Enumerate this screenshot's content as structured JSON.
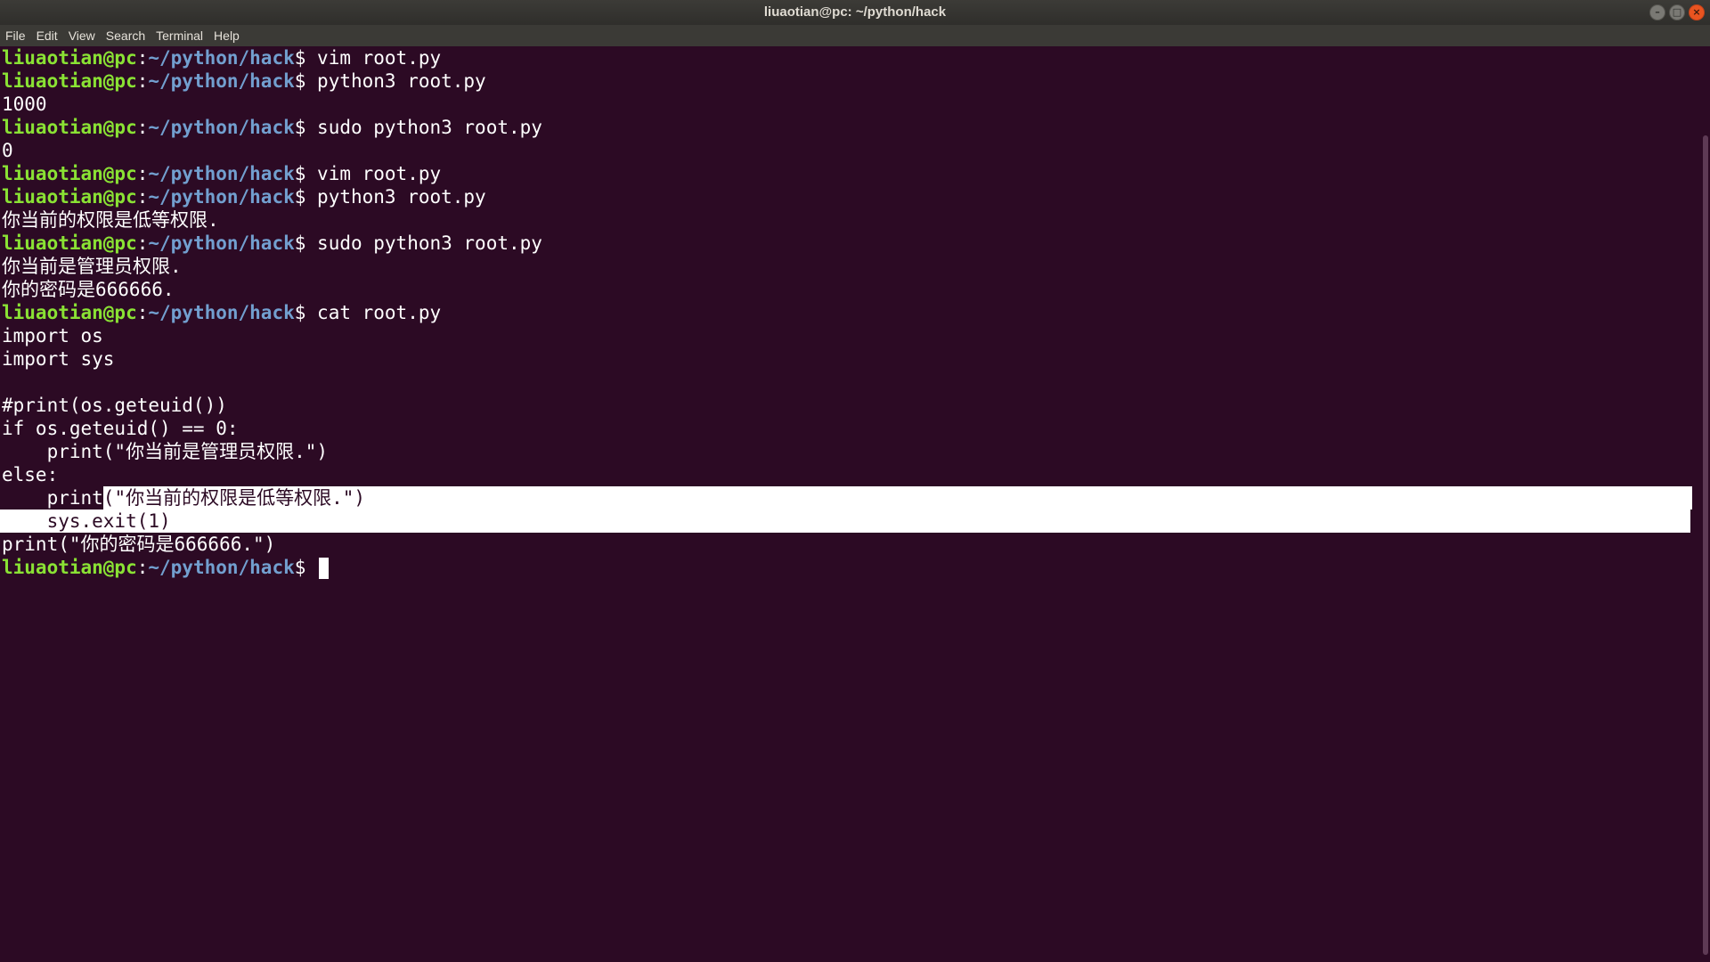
{
  "window": {
    "title": "liuaotian@pc: ~/python/hack",
    "buttons": {
      "minimize": "–",
      "maximize": "□",
      "close": "×"
    }
  },
  "menu": [
    "File",
    "Edit",
    "View",
    "Search",
    "Terminal",
    "Help"
  ],
  "prompt": {
    "user": "liuaotian@pc",
    "sep": ":",
    "path": "~/python/hack",
    "dollar": "$ "
  },
  "lines": [
    {
      "type": "prompt",
      "cmd": "vim root.py"
    },
    {
      "type": "prompt",
      "cmd": "python3 root.py"
    },
    {
      "type": "out",
      "text": "1000"
    },
    {
      "type": "prompt",
      "cmd": "sudo python3 root.py"
    },
    {
      "type": "out",
      "text": "0"
    },
    {
      "type": "prompt",
      "cmd": "vim root.py"
    },
    {
      "type": "prompt",
      "cmd": "python3 root.py"
    },
    {
      "type": "out",
      "text": "你当前的权限是低等权限."
    },
    {
      "type": "prompt",
      "cmd": "sudo python3 root.py"
    },
    {
      "type": "out",
      "text": "你当前是管理员权限."
    },
    {
      "type": "out",
      "text": "你的密码是666666."
    },
    {
      "type": "prompt",
      "cmd": "cat root.py"
    },
    {
      "type": "out",
      "text": "import os"
    },
    {
      "type": "out",
      "text": "import sys"
    },
    {
      "type": "out",
      "text": ""
    },
    {
      "type": "out",
      "text": "#print(os.geteuid())"
    },
    {
      "type": "out",
      "text": "if os.geteuid() == 0:"
    },
    {
      "type": "out",
      "text": "    print(\"你当前是管理员权限.\")"
    },
    {
      "type": "out",
      "text": "else:"
    },
    {
      "type": "selstart",
      "pre": "    print",
      "sel": "(\"你当前的权限是低等权限.\")"
    },
    {
      "type": "selfull",
      "text": "    sys.exit(1)"
    },
    {
      "type": "out",
      "text": "print(\"你的密码是666666.\")"
    },
    {
      "type": "prompt",
      "cmd": "",
      "cursor": true
    }
  ]
}
